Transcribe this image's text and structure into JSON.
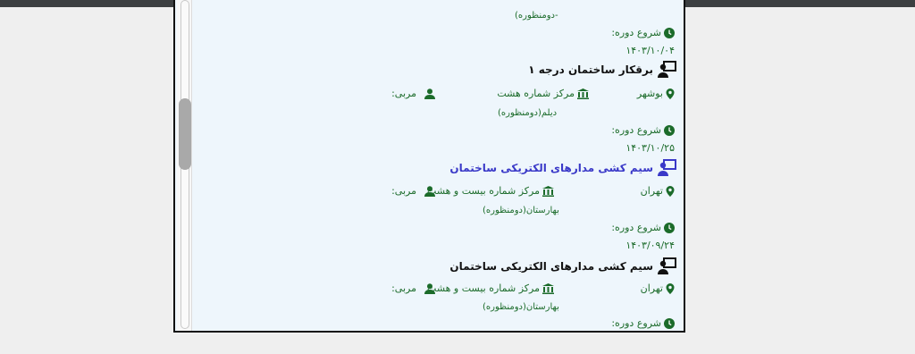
{
  "colors": {
    "green": "#1b6b2a",
    "link": "#3a39c8",
    "text": "#111111",
    "panel_bg": "#eef6fc"
  },
  "top_fragment": {
    "department": "-دومنظوره)"
  },
  "courses": [
    {
      "start_label": "شروع دوره:",
      "start_date": "۱۴۰۳/۱۰/۰۴"
    },
    {
      "title": "برقکار ساختمان درجه ۱",
      "city": "بوشهر",
      "center": "مرکز شماره هشت",
      "coach_label": "مربی:",
      "department": "دیلم(دومنظوره)",
      "start_label": "شروع دوره:",
      "start_date": "۱۴۰۳/۱۰/۲۵"
    },
    {
      "title": "سیم کشی مدارهای الکتریکی ساختمان",
      "city": "تهران",
      "center": "مرکز شماره بیست و هشت",
      "coach_label": "مربی:",
      "department": "بهارستان(دومنظوره)",
      "start_label": "شروع دوره:",
      "start_date": "۱۴۰۳/۰۹/۲۴"
    },
    {
      "title": "سیم کشی مدارهای الکتریکی ساختمان",
      "city": "تهران",
      "center": "مرکز شماره بیست و هشت",
      "coach_label": "مربی:",
      "department": "بهارستان(دومنظوره)",
      "start_label": "شروع دوره:"
    }
  ]
}
